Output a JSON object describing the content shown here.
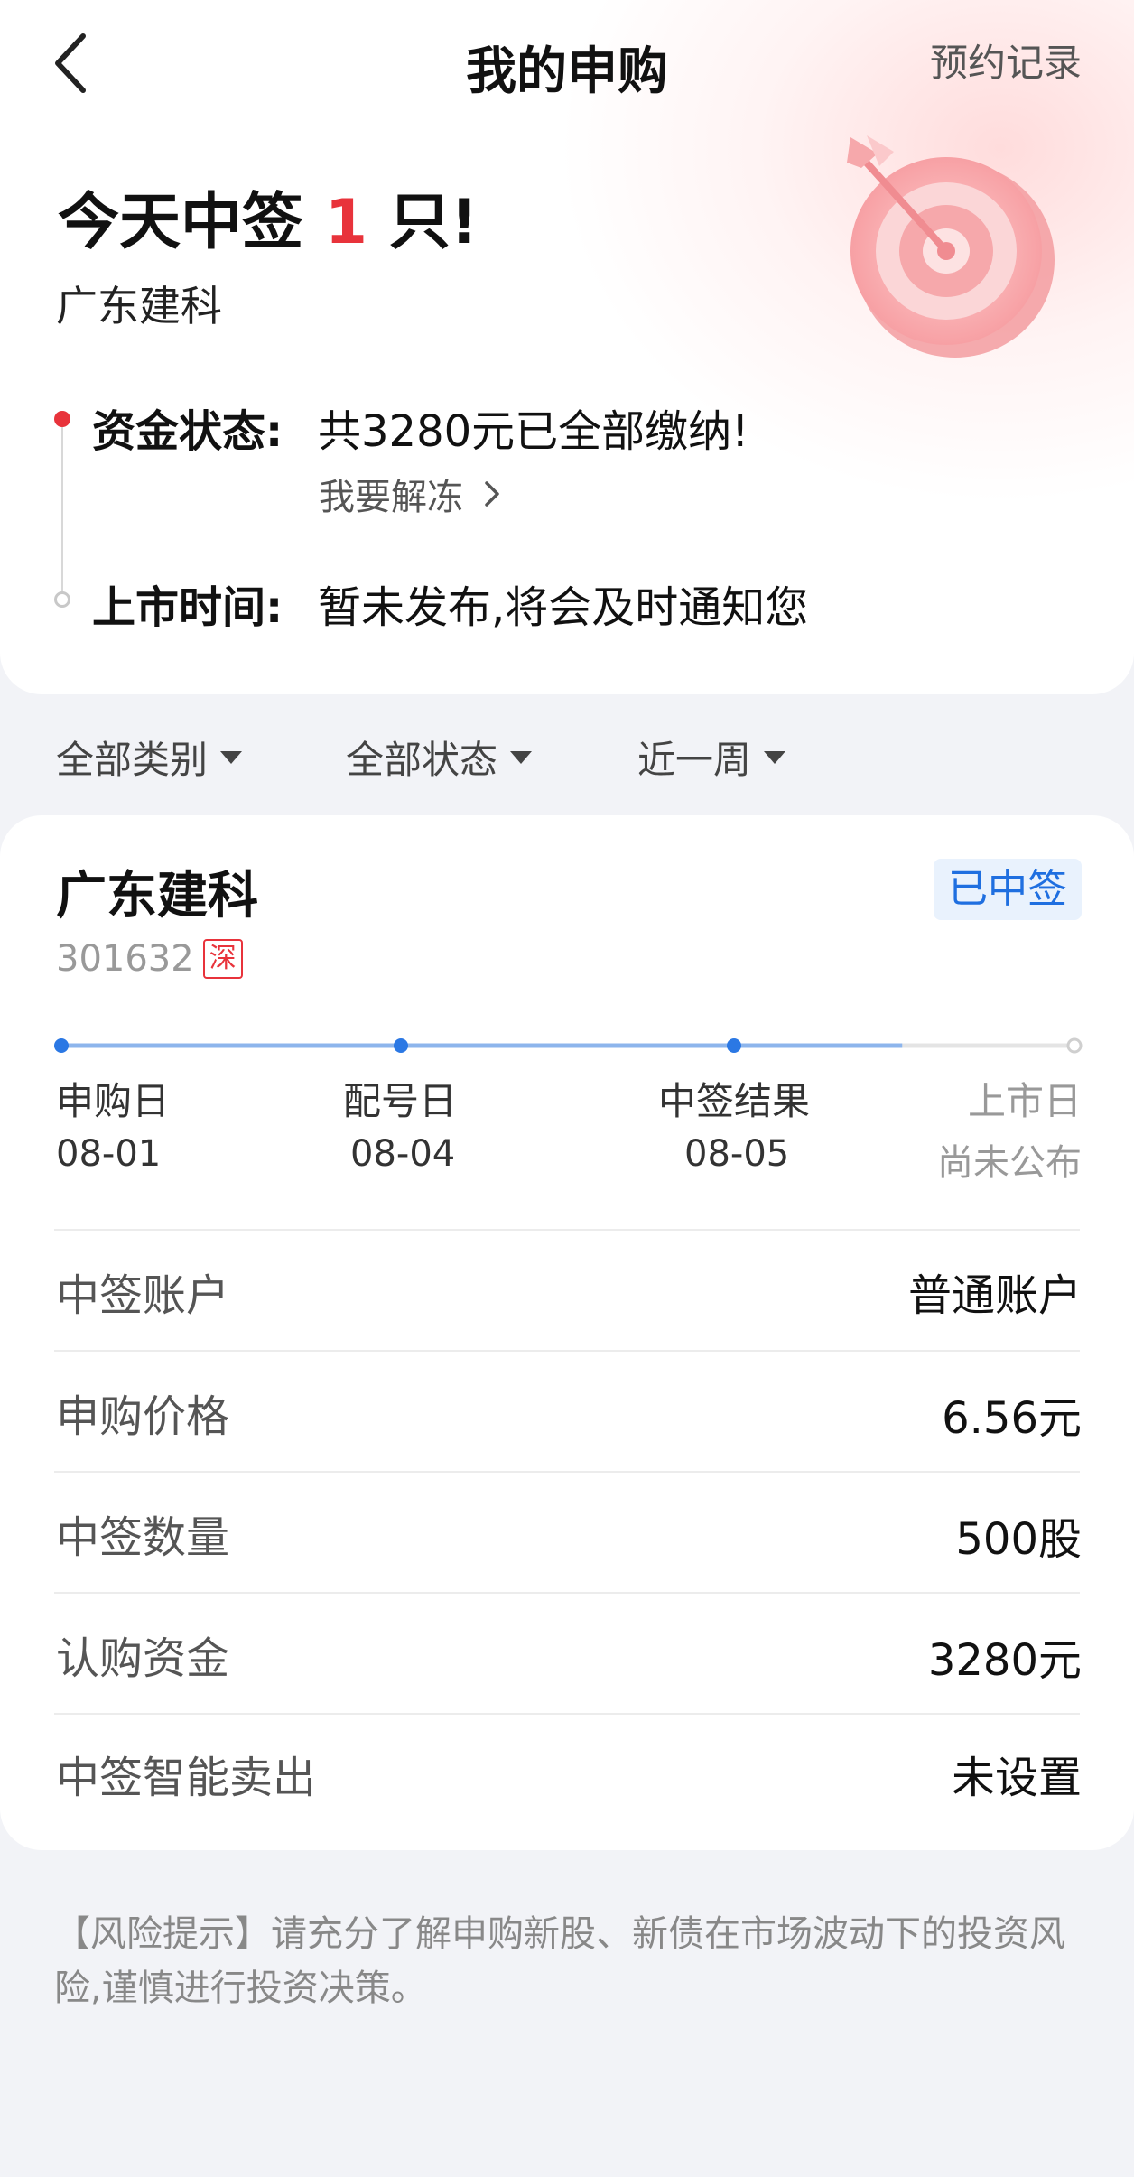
{
  "header": {
    "title": "我的申购",
    "reserve_records": "预约记录"
  },
  "summary": {
    "headline_prefix": "今天中签",
    "headline_count": "1",
    "headline_suffix": "只!",
    "stock_name": "广东建科",
    "fund_status_label": "资金状态:",
    "fund_status_value": "共3280元已全部缴纳!",
    "unfreeze_link": "我要解冻",
    "listing_label": "上市时间:",
    "listing_value": "暂未发布,将会及时通知您"
  },
  "filters": [
    {
      "label": "全部类别"
    },
    {
      "label": "全部状态"
    },
    {
      "label": "近一周"
    }
  ],
  "card": {
    "name": "广东建科",
    "status": "已中签",
    "code": "301632",
    "market": "深",
    "progress_fraction": 0.83,
    "steps": [
      {
        "label": "申购日",
        "date": "08-01"
      },
      {
        "label": "配号日",
        "date": "08-04"
      },
      {
        "label": "中签结果",
        "date": "08-05"
      },
      {
        "label": "上市日",
        "date": "尚未公布"
      }
    ],
    "rows": [
      {
        "label": "中签账户",
        "value": "普通账户"
      },
      {
        "label": "申购价格",
        "value": "6.56元"
      },
      {
        "label": "中签数量",
        "value": "500股"
      },
      {
        "label": "认购资金",
        "value": "3280元"
      },
      {
        "label": "中签智能卖出",
        "value": "未设置"
      }
    ]
  },
  "risk_notice": "【风险提示】请充分了解申购新股、新债在市场波动下的投资风险,谨慎进行投资决策。",
  "colors": {
    "accent_red": "#e8333b",
    "progress_blue": "#2b78e4",
    "badge_blue": "#1f6fe0"
  }
}
